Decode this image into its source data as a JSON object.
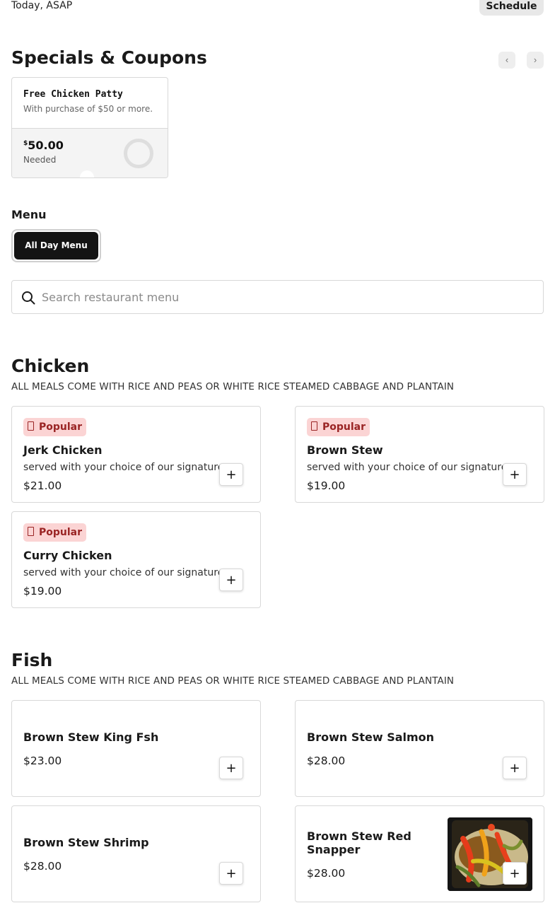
{
  "header": {
    "order_time": "Today, ASAP",
    "schedule_label": "Schedule"
  },
  "specials": {
    "title": "Specials & Coupons",
    "coupons": [
      {
        "name": "Free Chicken Patty",
        "description": "With purchase of $50 or more.",
        "currency": "$",
        "amount": "50.00",
        "status": "Needed",
        "progress": 0
      }
    ]
  },
  "menu": {
    "label": "Menu",
    "tabs": [
      {
        "label": "All Day Menu",
        "selected": true
      }
    ]
  },
  "search": {
    "placeholder": "Search restaurant menu",
    "value": ""
  },
  "sections": [
    {
      "title": "Chicken",
      "description": "ALL MEALS COME WITH RICE AND PEAS OR WHITE RICE STEAMED CABBAGE AND PLANTAIN",
      "items": [
        {
          "badge": "Popular",
          "name": "Jerk Chicken",
          "description": "served with your choice of our signature",
          "price": "$21.00"
        },
        {
          "badge": "Popular",
          "name": "Brown Stew",
          "description": "served with your choice of our signature",
          "price": "$19.00"
        },
        {
          "badge": "Popular",
          "name": "Curry Chicken",
          "description": "served with your choice of our signature",
          "price": "$19.00"
        }
      ]
    },
    {
      "title": "Fish",
      "description": "ALL MEALS COME WITH RICE AND PEAS OR WHITE RICE STEAMED CABBAGE AND PLANTAIN",
      "items": [
        {
          "name": "Brown Stew King Fsh",
          "price": "$23.00"
        },
        {
          "name": "Brown Stew Salmon",
          "price": "$28.00"
        },
        {
          "name": "Brown Stew Shrimp",
          "price": "$28.00"
        },
        {
          "name": "Brown Stew Red Snapper",
          "price": "$28.00",
          "image": "food-photo"
        }
      ]
    }
  ],
  "icons": {
    "add": "+",
    "prev": "‹",
    "next": "›"
  },
  "colors": {
    "badge_bg": "#fbd4d4",
    "badge_text": "#9a2424",
    "primary_dark": "#141414"
  }
}
